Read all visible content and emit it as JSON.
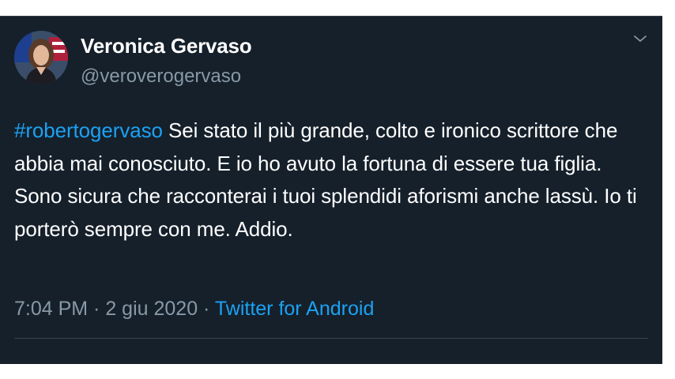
{
  "tweet": {
    "author": {
      "display_name": "Veronica Gervaso",
      "handle": "@veroverogervaso",
      "avatar_icon": "profile-photo"
    },
    "menu_icon": "chevron-down-icon",
    "hashtag": "#robertogervaso",
    "text": " Sei stato il più grande, colto e ironico scrittore che abbia mai conosciuto. E io ho avuto la fortuna di essere tua figlia. Sono sicura che racconterai i tuoi splendidi aforismi anche lassù. Io ti porterò sempre con me. Addio.",
    "time": "7:04 PM",
    "separator": " · ",
    "date": "2 giu 2020",
    "source": "Twitter for Android"
  },
  "colors": {
    "background": "#15202b",
    "text": "#ffffff",
    "secondary_text": "#8899a6",
    "accent": "#1da1f2",
    "divider": "#38444d"
  }
}
